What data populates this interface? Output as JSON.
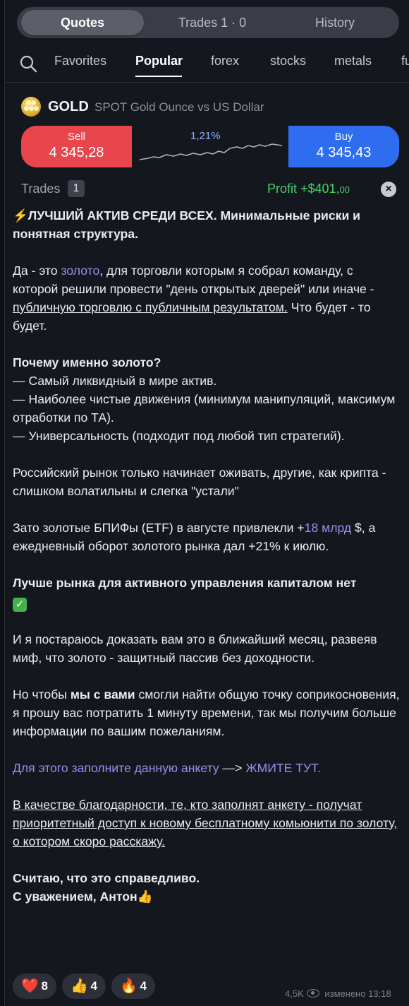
{
  "tabs": {
    "quotes": "Quotes",
    "trades": "Trades 1 · 0",
    "history": "History"
  },
  "categories": [
    "Favorites",
    "Popular",
    "forex",
    "stocks",
    "metals",
    "fu"
  ],
  "asset": {
    "symbol": "GOLD",
    "name": "SPOT Gold Ounce vs US Dollar",
    "sell_label": "Sell",
    "sell_price": "4 345,28",
    "buy_label": "Buy",
    "buy_price": "4 345,43",
    "change": "1,21%"
  },
  "trades_label": "Trades",
  "trades_count": "1",
  "profit_main": "Profit +$401,",
  "profit_cents": "00",
  "message": {
    "p1": "⚡ЛУЧШИЙ АКТИВ СРЕДИ ВСЕХ. Минимальные риски и понятная структура.",
    "p2a": "Да - это ",
    "p2_link": "золото",
    "p2b": ", для торговли которым я собрал команду, с которой решили провести \"день открытых дверей\" или иначе -",
    "p2_u": " публичную торговлю с публичным результатом.",
    "p2c": " Что будет - то будет.",
    "p3_head": "Почему именно золото?",
    "p3_l1": "— Самый ликвидный в мире актив.",
    "p3_l2": "— Наиболее чистые движения (минимум манипуляций, максимум отработки по ТА).",
    "p3_l3": "— Универсальность (подходит под любой тип стратегий).",
    "p4": "Российский рынок только начинает оживать, другие, как крипта - слишком волатильны и слегка \"устали\"",
    "p5a": "Зато золотые БПИФы (ETF) в августе привлекли +",
    "p5_link": "18 млрд",
    "p5b": " $, а ежедневный оборот золотого рынка дал +21% к июлю.",
    "p6": "Лучше рынка для активного управления капиталом нет",
    "p7": "И я постараюсь доказать вам это в ближайший месяц, развеяв миф, что золото - защитный пассив без доходности.",
    "p8a": "Но чтобы ",
    "p8_bold": "мы с вами",
    "p8b": " смогли найти общую точку соприкосновения, я прошу вас потратить 1 минуту времени, так мы получим больше информации по вашим пожеланиям.",
    "p9_link": "Для этого заполните данную анкету",
    "p9_arrow": " —> ",
    "p9_link2": "ЖМИТЕ ТУТ.",
    "p10": "В качестве благодарности, те, кто заполнят анкету - получат приоритетный доступ к новому бесплатному комьюнити по золоту, о котором скоро расскажу.",
    "p11_l1": "Считаю, что это справедливо.",
    "p11_l2": "С уважением, Антон👍"
  },
  "reactions": [
    {
      "emoji": "❤️",
      "count": "8"
    },
    {
      "emoji": "👍",
      "count": "4"
    },
    {
      "emoji": "🔥",
      "count": "4"
    }
  ],
  "views": "4,5K",
  "edited": "изменено 13:18",
  "colors": {
    "sell": "#e8454d",
    "buy": "#2f6df0",
    "profit": "#3fd06a",
    "link": "#9c8cf0"
  }
}
